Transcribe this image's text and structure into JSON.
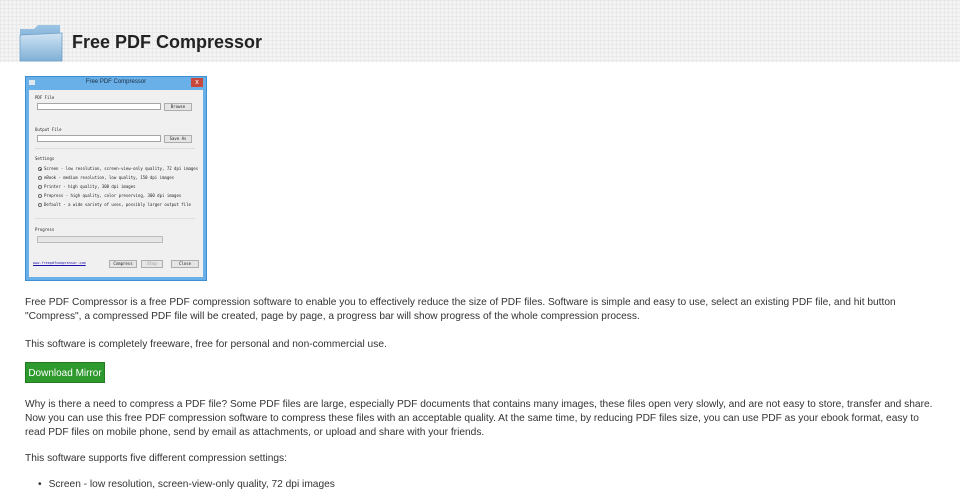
{
  "header": {
    "title": "Free PDF Compressor",
    "icon": "folder-icon"
  },
  "app_window": {
    "title": "Free PDF Compressor",
    "pdf_file_label": "PDF File",
    "browse_label": "Browse",
    "output_file_label": "Output File",
    "save_as_label": "Save As",
    "settings_label": "Settings",
    "options": [
      {
        "label": "Screen - low resolution, screen-view-only quality, 72 dpi images",
        "selected": true
      },
      {
        "label": "eBook - medium resolution, low quality, 150 dpi images",
        "selected": false
      },
      {
        "label": "Printer - high quality, 300 dpi images",
        "selected": false
      },
      {
        "label": "Prepress - high quality, color preserving, 300 dpi images",
        "selected": false
      },
      {
        "label": "Default - a wide variety of uses, possibly larger output file",
        "selected": false
      }
    ],
    "progress_label": "Progress",
    "website_link": "www.freepdfcompressor.com",
    "compress_label": "Compress",
    "stop_label": "Stop",
    "close_label": "Close",
    "close_x": "x"
  },
  "content": {
    "p1": "Free PDF Compressor is a free PDF compression software to enable you to effectively reduce the size of PDF files. Software is simple and easy to use, select an existing PDF file, and hit button \"Compress\", a compressed PDF file will be created, page by page, a progress bar will show progress of the whole compression process.",
    "p2": "This software is completely freeware, free for personal and non-commercial use.",
    "download_label": "Download Mirror",
    "p3": "Why is there a need to compress a PDF file? Some PDF files are large, especially PDF documents that contains many images, these files open very slowly, and are not easy to store, transfer and share. Now you can use this free PDF compression software to compress these files with an acceptable quality. At the same time, by reducing PDF files size, you can use PDF as your ebook format, easy to read PDF files on mobile phone, send by email as attachments, or upload and share with your friends.",
    "p4": "This software supports five different compression settings:",
    "bullets": [
      "Screen - low resolution, screen-view-only quality, 72 dpi images"
    ]
  },
  "colors": {
    "download_button": "#2e9a2e",
    "window_frame": "#6ab0e8",
    "close_button": "#c9483c"
  }
}
